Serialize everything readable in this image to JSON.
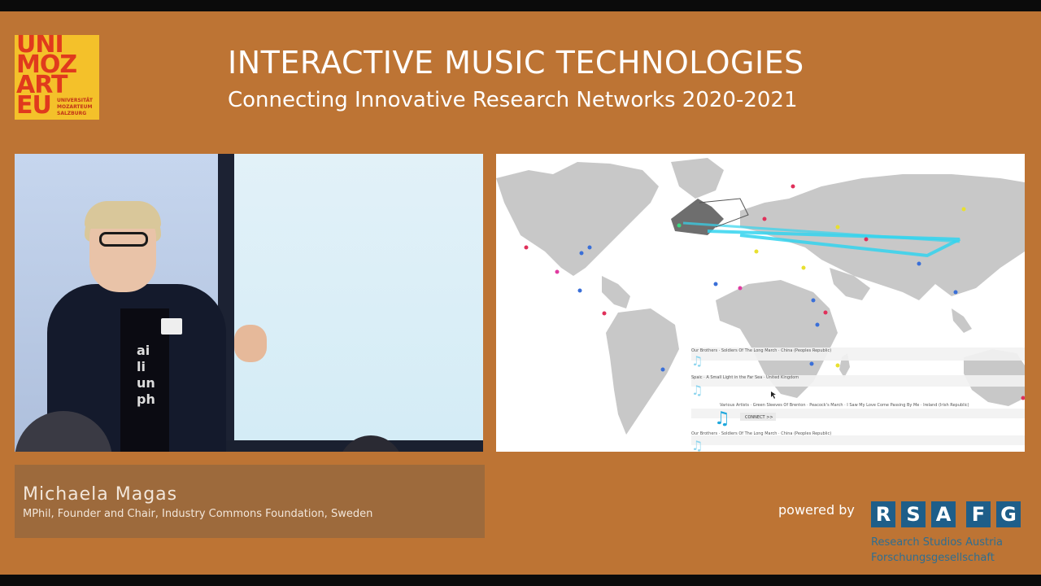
{
  "header": {
    "title": "INTERACTIVE MUSIC TECHNOLOGIES",
    "subtitle": "Connecting Innovative Research Networks 2020-2021"
  },
  "logo": {
    "lines": [
      "UNI",
      "MOZ",
      "ART",
      "EU"
    ],
    "sub": "UNIVERSITÄT MOZARTEUM SALZBURG"
  },
  "speaker": {
    "name": "Michaela Magas",
    "role": "MPhil, Founder and Chair, Industry Commons Foundation, Sweden",
    "shirt_text": "ai\nli\nun\nph"
  },
  "slide": {
    "tracks": [
      "Our Brothers · Soldiers Of The Long March · China (Peoples Republic)",
      "Spaic · A Small Light in the Far Sea · United Kingdom",
      "Various Artists · Green Sleeves Of Brenton · Peacock's March · I Saw My Love Come Passing By Me · Ireland (Irish Republic)",
      "Our Brothers · Soldiers Of The Long March · China (Peoples Republic)"
    ],
    "connect_label": "CONNECT >>"
  },
  "sponsor": {
    "powered_by": "powered by",
    "letters": [
      "R",
      "S",
      "A",
      "F",
      "G"
    ],
    "line1": "Research Studios Austria",
    "line2": "Forschungsgesellschaft"
  },
  "colors": {
    "background": "#bd7434",
    "name_box": "#9d6a3c",
    "logo_yellow": "#f4c12a",
    "logo_red": "#e03a1d",
    "rsa_blue": "#1e5e89",
    "map_land": "#c8c8c8",
    "connection_line": "#33d4ee"
  }
}
